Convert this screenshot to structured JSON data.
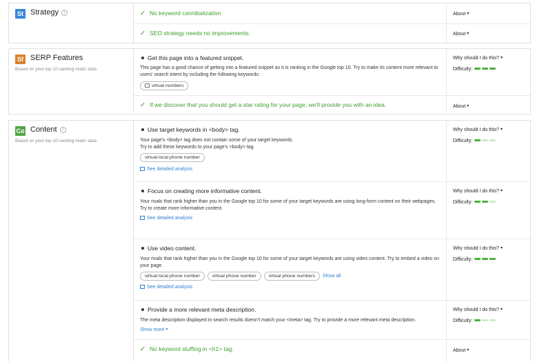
{
  "strategy": {
    "badge": "St",
    "title": "Strategy",
    "rows": [
      {
        "text": "No keyword cannibalization",
        "about": "About"
      },
      {
        "text": "SEO strategy needs no improvements.",
        "about": "About"
      }
    ]
  },
  "serp": {
    "badge": "Sf",
    "title": "SERP Features",
    "subtitle": "Based on your top 10-ranking rivals' data",
    "task": {
      "title": "Get this page into a featured snippet.",
      "desc": "This page has a good chance of getting into a featured snippet as it is ranking in the Google top 10. Try to make its content more relevant to users' search intent by including the following keywords:",
      "chip": "virtual numbers",
      "why": "Why should I do this?",
      "difficulty_label": "Difficulty:",
      "difficulty": 3
    },
    "ok": {
      "text": "If we discover that you should get a star rating for your page, we'll provide you with an idea.",
      "about": "About"
    }
  },
  "content": {
    "badge": "Co",
    "title": "Content",
    "subtitle": "Based on your top 10-ranking rivals' data",
    "tasks": [
      {
        "title": "Use target keywords in <body> tag.",
        "desc1": "Your page's <body> tag does not contain some of your target keywords.",
        "desc2": "Try to add these keywords to your page's <body> tag.",
        "chips": [
          "virtual local phone number"
        ],
        "link": "See detailed analysis",
        "why": "Why should I do this?",
        "difficulty_label": "Difficulty:",
        "difficulty": 1
      },
      {
        "title": "Focus on creating more informative content.",
        "desc1": "Your rivals that rank higher than you in the Google top 10 for some of your target keywords are using long-form content on their webpages.",
        "desc2": "Try to create more informative content.",
        "link": "See detailed analysis",
        "why": "Why should I do this?",
        "difficulty_label": "Difficulty:",
        "difficulty": 2
      },
      {
        "title": "Use video content.",
        "desc1": "Your rivals that rank higher than you in the Google top 10 for some of your target keywords are using video content. Try to embed a video on your page.",
        "chips": [
          "virtual local phone number",
          "virtual phone number",
          "virtual phone numbers"
        ],
        "show_all": "Show all",
        "link": "See detailed analysis",
        "why": "Why should I do this?",
        "difficulty_label": "Difficulty:",
        "difficulty": 3
      },
      {
        "title": "Provide a more relevant meta description.",
        "desc1": "The meta description displayed in search results doesn't match your <meta> tag. Try to provide a more relevant meta description.",
        "show_more": "Show more",
        "why": "Why should I do this?",
        "difficulty_label": "Difficulty:",
        "difficulty": 1
      }
    ],
    "ok": {
      "text": "No keyword stuffing in <h1> tag.",
      "about": "About"
    }
  },
  "colors": {
    "success": "#3f9d2f",
    "link": "#2f7fd0",
    "strategy_badge": "#3b89d8",
    "serp_badge": "#d9822b",
    "content_badge": "#53a545"
  }
}
